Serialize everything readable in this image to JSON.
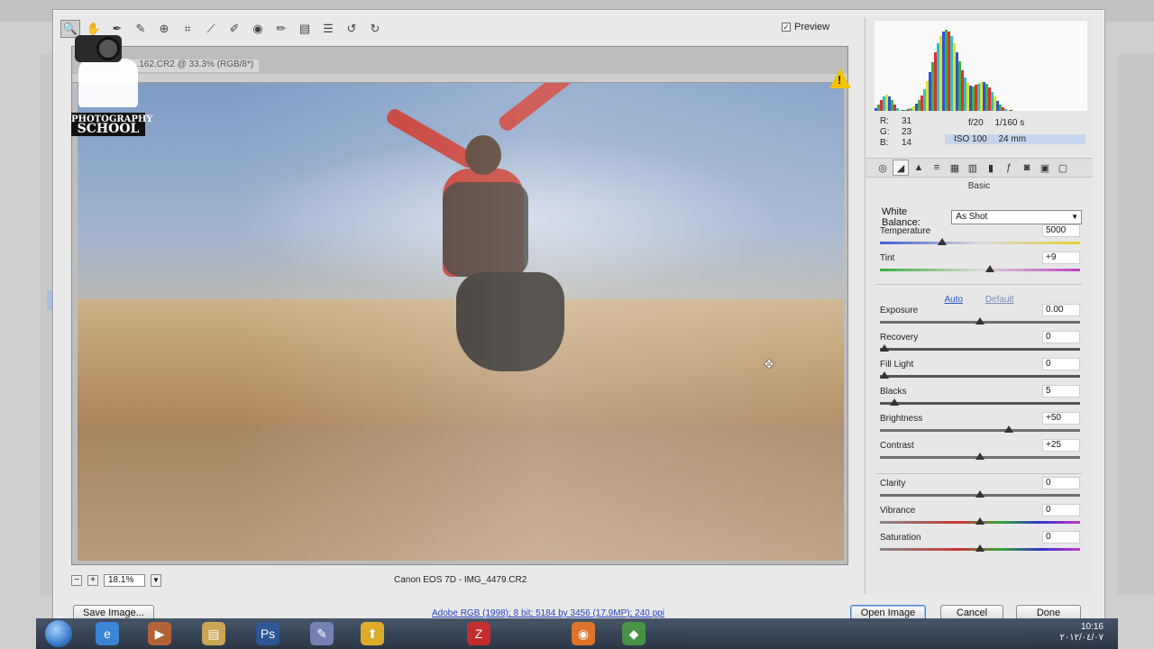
{
  "dialog": {
    "preview_label": "Preview",
    "preview_checked": true,
    "doc_tab": "...162.CR2 @ 33.3% (RGB/8*)",
    "zoom_value": "18.1%",
    "camera_label": "Canon EOS 7D  -  IMG_4479.CR2",
    "tools": [
      "zoom-icon",
      "hand-icon",
      "white-balance-icon",
      "color-sampler-icon",
      "target-adjust-icon",
      "crop-icon",
      "straighten-icon",
      "spot-removal-icon",
      "red-eye-icon",
      "adjustment-brush-icon",
      "graduated-filter-icon",
      "preferences-icon",
      "rotate-left-icon",
      "rotate-right-icon"
    ]
  },
  "logo": {
    "line1": "PHOTOGRAPHY",
    "line2": "SCHOOL"
  },
  "readout": {
    "r_label": "R:",
    "r_value": "31",
    "g_label": "G:",
    "g_value": "23",
    "b_label": "B:",
    "b_value": "14",
    "aperture": "f/20",
    "shutter": "1/160 s",
    "iso": "ISO 100",
    "focal": "24 mm"
  },
  "panel": {
    "section_title": "Basic",
    "white_balance_label": "White Balance:",
    "white_balance_value": "As Shot",
    "auto_label": "Auto",
    "default_label": "Default",
    "sliders": [
      {
        "label": "Temperature",
        "value": "5000",
        "pos": 0.3
      },
      {
        "label": "Tint",
        "value": "+9",
        "pos": 0.55
      },
      {
        "label": "Exposure",
        "value": "0.00",
        "pos": 0.5
      },
      {
        "label": "Recovery",
        "value": "0",
        "pos": 0.0
      },
      {
        "label": "Fill Light",
        "value": "0",
        "pos": 0.0
      },
      {
        "label": "Blacks",
        "value": "5",
        "pos": 0.05
      },
      {
        "label": "Brightness",
        "value": "+50",
        "pos": 0.65
      },
      {
        "label": "Contrast",
        "value": "+25",
        "pos": 0.5
      },
      {
        "label": "Clarity",
        "value": "0",
        "pos": 0.5
      },
      {
        "label": "Vibrance",
        "value": "0",
        "pos": 0.5
      },
      {
        "label": "Saturation",
        "value": "0",
        "pos": 0.5
      }
    ]
  },
  "bottom": {
    "save_label": "Save Image...",
    "workflow_link": "Adobe RGB (1998); 8 bit; 5184 by 3456 (17.9MP); 240 ppi",
    "open_label": "Open Image",
    "cancel_label": "Cancel",
    "done_label": "Done"
  },
  "taskbar": {
    "time": "10:16",
    "date": "٢٠١٢/٠٤/٠٧"
  }
}
